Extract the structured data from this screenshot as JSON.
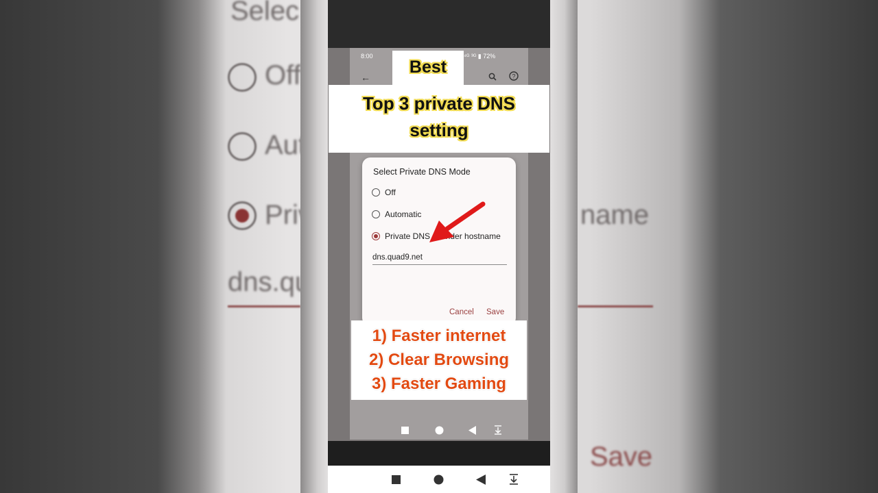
{
  "status_bar": {
    "time": "8:00",
    "indicators": "⁴ᴳ ³ᴳ ▮ 72%"
  },
  "overlay": {
    "best": "Best",
    "title_line1": "Top 3 private DNS",
    "title_line2": "setting",
    "list": [
      "1) Faster internet",
      "2) Clear Browsing",
      "3) Faster Gaming"
    ]
  },
  "dialog": {
    "title": "Select Private DNS Mode",
    "options": [
      {
        "label": "Off",
        "selected": false
      },
      {
        "label": "Automatic",
        "selected": false
      },
      {
        "label": "Private DNS provider hostname",
        "selected": true
      }
    ],
    "hostname_value": "dns.quad9.net",
    "cancel_label": "Cancel",
    "save_label": "Save"
  },
  "background": {
    "texts": [
      "Selec",
      "Off",
      "Aut",
      "Priv",
      "name",
      "dns.qu",
      "Save"
    ]
  },
  "colors": {
    "accent": "#9c3a3a",
    "list_text": "#e24a12",
    "title_glow": "#f2dc52",
    "arrow": "#e01a1a"
  },
  "icons": {
    "back": "back-arrow-icon",
    "search": "search-icon",
    "help": "help-icon",
    "nav": [
      "square-icon",
      "circle-icon",
      "triangle-back-icon",
      "menu-down-icon"
    ]
  }
}
